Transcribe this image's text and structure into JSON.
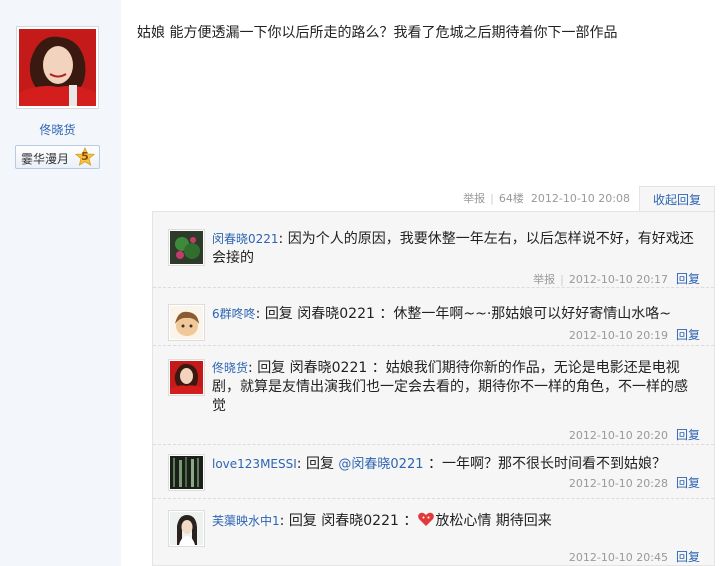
{
  "author": {
    "name": "佟晓货",
    "level_name": "霎华漫月",
    "level_num": "5"
  },
  "post": {
    "content": "姑娘 能方便透漏一下你以后所走的路么？我看了危城之后期待着你下一部作品",
    "report": "举报",
    "floor": "64楼",
    "time": "2012-10-10 20:08",
    "collapse_label": "收起回复"
  },
  "replies": [
    {
      "user": "闵春晓0221",
      "text": "因为个人的原因，我要休整一年左右，以后怎样说不好，有好戏还会接的",
      "report": "举报",
      "time": "2012-10-10 20:17",
      "reply_label": "回复"
    },
    {
      "user": "6群咚咚",
      "prefix": "回复 闵春晓0221",
      "text": "：休整一年啊~~·那姑娘可以好好寄情山水咯~",
      "time": "2012-10-10 20:19",
      "reply_label": "回复"
    },
    {
      "user": "佟晓货",
      "prefix": "回复 闵春晓0221",
      "text": "：姑娘我们期待你新的作品，无论是电影还是电视剧，就算是友情出演我们也一定会去看的，期待你不一样的角色，不一样的感觉",
      "time": "2012-10-10 20:20",
      "reply_label": "回复"
    },
    {
      "user": "love123MESSI",
      "prefix": "回复 ",
      "at": "@闵春晓0221",
      "text": " ：一年啊？那不很长时间看不到姑娘？",
      "time": "2012-10-10 20:28",
      "reply_label": "回复"
    },
    {
      "user": "芙蕖映水中1",
      "prefix": "回复 闵春晓0221",
      "text_a": "：",
      "text_b": "放松心情 期待回来",
      "time": "2012-10-10 20:45",
      "reply_label": "回复"
    }
  ]
}
